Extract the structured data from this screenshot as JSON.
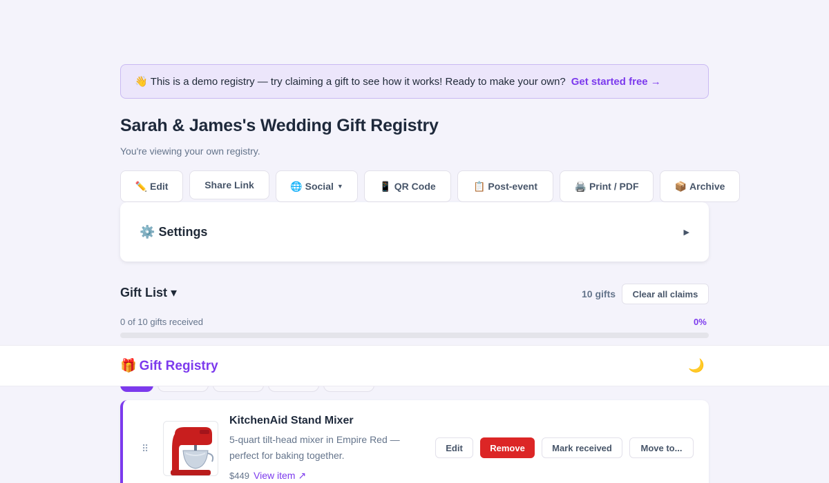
{
  "banner": {
    "icon": "👋",
    "text": "This is a demo registry — try claiming a gift to see how it works! Ready to make your own?",
    "cta": "Get started free →"
  },
  "registry": {
    "title": "Sarah & James's Wedding Gift Registry",
    "subtitle": "You're viewing your own registry."
  },
  "toolbar": {
    "edit": {
      "icon": "✏️",
      "label": "Edit"
    },
    "share": {
      "label": "Share Link"
    },
    "social": {
      "icon": "🌐",
      "label": "Social"
    },
    "qr": {
      "icon": "📱",
      "label": "QR Code"
    },
    "post_event": {
      "icon": "📋",
      "label": "Post-event"
    },
    "print": {
      "icon": "🖨️",
      "label": "Print / PDF"
    },
    "archive": {
      "icon": "📦",
      "label": "Archive"
    }
  },
  "settings": {
    "icon": "⚙️",
    "label": "Settings",
    "arrow": "▶"
  },
  "gift_list": {
    "heading": "Gift List ▾",
    "count": "10 gifts",
    "clear_label": "Clear all claims",
    "progress_label": "0 of 10 gifts received",
    "progress_pct": "0%",
    "progress_fraction": 0
  },
  "navbar": {
    "gift_icon": "🎁",
    "brand": "Gift Registry",
    "theme_icon": "🌙"
  },
  "items": [
    {
      "name": "KitchenAid Stand Mixer",
      "description": "5-quart tilt-head mixer in Empire Red — perfect for baking together.",
      "price": "$449",
      "link": "View item ↗",
      "actions": {
        "edit": "Edit",
        "remove": "Remove",
        "received": "Mark received",
        "move": "Move to..."
      }
    }
  ],
  "colors": {
    "accent": "#7c3aed",
    "danger": "#dc2626",
    "background": "#f4f3fb"
  }
}
